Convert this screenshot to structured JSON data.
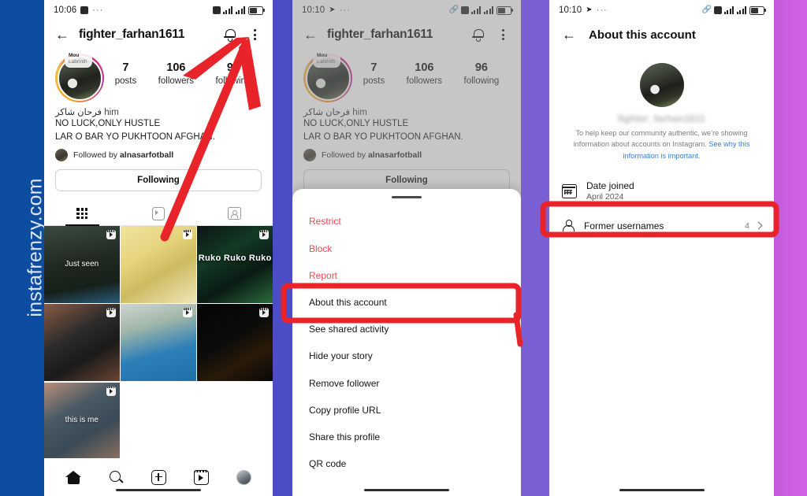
{
  "watermark": {
    "text": "instafrenzy.com"
  },
  "colors": {
    "band_blue": "#0d4da1",
    "band_violet": "#4c4cc4",
    "band_purple": "#7b5fd4",
    "band_magenta": "#c35bdd",
    "annotation_red": "#e8242a",
    "danger_red": "#ed4956",
    "link_blue": "#3b7fd4"
  },
  "panel_left": {
    "status": {
      "time": "10:06",
      "dots": "···",
      "battery": "31"
    },
    "header": {
      "back_icon": "arrow-back-icon",
      "title": "fighter_farhan1611",
      "bell_icon": "bell-icon",
      "menu_icon": "kebab-menu-icon"
    },
    "profile": {
      "music_sticker": {
        "title": "Mou",
        "artist": "Labrinth"
      },
      "stats": [
        {
          "num": "7",
          "label": "posts"
        },
        {
          "num": "106",
          "label": "followers"
        },
        {
          "num": "96",
          "label": "following"
        }
      ],
      "name_arabic": "فرحان شاکر",
      "pronoun": "him",
      "bio_line1": "NO LUCK,ONLY HUSTLE",
      "bio_line2": "LAR O BAR YO PUKHTOON AFGHAN.",
      "followed_by_prefix": "Followed by",
      "followed_by_user": "alnasarfotball",
      "follow_button": "Following"
    },
    "tabs": [
      {
        "name": "grid-tab",
        "icon": "grid-icon",
        "active": true
      },
      {
        "name": "reels-tab",
        "icon": "reels-icon",
        "active": false
      },
      {
        "name": "tagged-tab",
        "icon": "tagged-icon",
        "active": false
      }
    ],
    "posts": [
      {
        "caption": "Just seen",
        "bold": false,
        "reel": true
      },
      {
        "caption": "",
        "bold": false,
        "reel": true
      },
      {
        "caption": "Ruko Ruko Ruko",
        "bold": true,
        "reel": true
      },
      {
        "caption": "",
        "bold": false,
        "reel": true
      },
      {
        "caption": "",
        "bold": false,
        "reel": true
      },
      {
        "caption": "",
        "bold": false,
        "reel": true
      },
      {
        "caption": "this is me",
        "bold": false,
        "reel": true
      }
    ],
    "bottom_nav": [
      "home-icon",
      "search-icon",
      "add-post-icon",
      "reels-icon",
      "profile-avatar"
    ]
  },
  "panel_mid": {
    "status": {
      "time": "10:10",
      "dots": "···",
      "battery": "33"
    },
    "header": {
      "back_icon": "arrow-back-icon",
      "title": "fighter_farhan1611",
      "bell_icon": "bell-icon",
      "menu_icon": "kebab-menu-icon"
    },
    "profile": {
      "music_sticker": {
        "title": "Mou",
        "artist": "Labrinth"
      },
      "stats": [
        {
          "num": "7",
          "label": "posts"
        },
        {
          "num": "106",
          "label": "followers"
        },
        {
          "num": "96",
          "label": "following"
        }
      ],
      "name_arabic": "فرحان شاکر",
      "pronoun": "him",
      "bio_line1": "NO LUCK,ONLY HUSTLE",
      "bio_line2": "LAR O BAR YO PUKHTOON AFGHAN.",
      "followed_by_prefix": "Followed by",
      "followed_by_user": "alnasarfotball",
      "follow_button": "Following"
    },
    "sheet": {
      "items": [
        {
          "label": "Restrict",
          "danger": true
        },
        {
          "label": "Block",
          "danger": true
        },
        {
          "label": "Report",
          "danger": true
        },
        {
          "label": "About this account",
          "danger": false,
          "highlighted": true
        },
        {
          "label": "See shared activity",
          "danger": false
        },
        {
          "label": "Hide your story",
          "danger": false
        },
        {
          "label": "Remove follower",
          "danger": false
        },
        {
          "label": "Copy profile URL",
          "danger": false
        },
        {
          "label": "Share this profile",
          "danger": false
        },
        {
          "label": "QR code",
          "danger": false
        }
      ]
    }
  },
  "panel_right": {
    "status": {
      "time": "10:10",
      "dots": "···",
      "battery": "32"
    },
    "header": {
      "back_icon": "arrow-back-icon",
      "title": "About this account"
    },
    "username_blurred": "fighter_farhan1611",
    "disclaimer_text": "To help keep our community authentic, we’re showing information about accounts on Instagram. ",
    "disclaimer_link": "See why this information is important",
    "disclaimer_end": ".",
    "rows": [
      {
        "icon": "calendar-icon",
        "label": "Date joined",
        "value": "April 2024",
        "count": "",
        "chevron": false
      },
      {
        "icon": "person-icon",
        "label": "Former usernames",
        "value": "",
        "count": "4",
        "chevron": true,
        "highlighted": true
      }
    ]
  },
  "annotations": {
    "arrow": {
      "name": "red-arrow-pointing-to-menu",
      "color": "#e8242a"
    },
    "box_about": {
      "name": "red-highlight-about-this-account"
    },
    "box_former": {
      "name": "red-highlight-former-usernames"
    }
  }
}
